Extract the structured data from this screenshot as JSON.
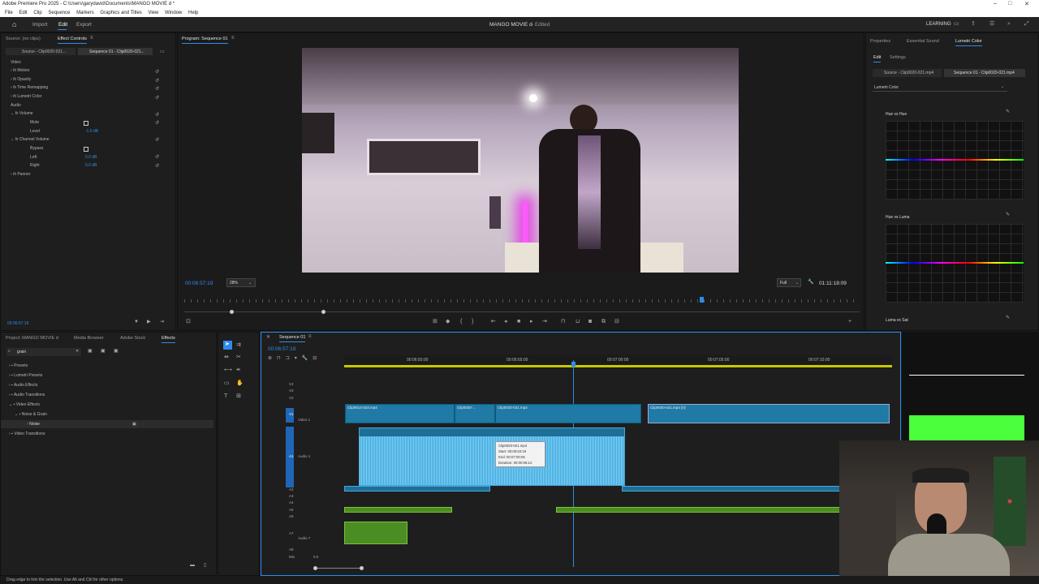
{
  "window": {
    "title": "Adobe Premiere Pro 2025 - C:\\Users\\garydavid\\Documents\\MANGO MOVIE d *"
  },
  "menu": [
    "File",
    "Edit",
    "Clip",
    "Sequence",
    "Markers",
    "Graphics and Titles",
    "View",
    "Window",
    "Help"
  ],
  "header": {
    "import": "Import",
    "edit": "Edit",
    "export": "Export",
    "doc_title": "MANGO MOVIE d",
    "doc_status": "- Edited",
    "learning": "LEARNING"
  },
  "effect_controls": {
    "tabs": [
      "Source: (no clips)",
      "Effect Controls"
    ],
    "source_tab": "Source - Clip0020-021...",
    "sequence_tab": "Sequence 01 - Clip0020-021...",
    "video_heading": "Video",
    "video_items": [
      "Motion",
      "Opacity",
      "Time Remapping",
      "Lumetri Color"
    ],
    "audio_heading": "Audio",
    "volume": "Volume",
    "mute": "Mute",
    "level": "Level",
    "level_value": "-1.6 dB",
    "channel_volume": "Channel Volume",
    "bypass": "Bypass",
    "left": "Left",
    "left_value": "0.0 dB",
    "right": "Right",
    "right_value": "0.0 dB",
    "panner": "Panner",
    "timecode": "00:06:57:19"
  },
  "program": {
    "tab": "Program: Sequence 01",
    "timecode": "00:06:57:19",
    "zoom": "28%",
    "quality": "Full",
    "duration": "01:11:18:09"
  },
  "lumetri": {
    "tabs": [
      "Properties",
      "Essential Sound",
      "Lumetri Color"
    ],
    "subtabs": [
      "Edit",
      "Settings"
    ],
    "source": "Source - Clip0020-021.mp4",
    "sequence": "Sequence 01 - Clip0020-021.mp4",
    "effect_select": "Lumetri Color",
    "curve1": "Hue vs Hue",
    "curve2": "Hue vs Luma",
    "curve3": "Luma vs Sat"
  },
  "project": {
    "tabs": [
      "Project: MANGO MOVIE d",
      "Media Browser",
      "Adobe Stock",
      "Effects"
    ],
    "search": "grain",
    "tree": [
      "Presets",
      "Lumetri Presets",
      "Audio Effects",
      "Audio Transitions",
      "Video Effects",
      "Noise & Grain",
      "Noise",
      "Video Transitions"
    ]
  },
  "timeline": {
    "tab": "Sequence 01",
    "timecode": "00:06:57:19",
    "ruler": [
      "00:06:50:00",
      "00:06:55:00",
      "00:07:00:00",
      "00:07:05:00",
      "00:07:10:00"
    ],
    "tracks_video": [
      "V4",
      "V3",
      "V2",
      "V1"
    ],
    "video1": "Video 1",
    "tracks_audio": [
      "A1",
      "A2",
      "A3",
      "A4",
      "A5",
      "A6",
      "A7",
      "A8"
    ],
    "audio1": "Audio 1",
    "audio7": "Audio 7",
    "mix": "Mix",
    "mix_value": "0.0",
    "clips": [
      "Clip0014-024.mp4",
      "Clip0020-...",
      "Clip0020-021.mp4",
      "Clip0020-021.mp4 [V]"
    ],
    "tooltip": {
      "name": "Clip0020-021.mp4",
      "start": "Start: 00:06:53:19",
      "end": "End: 00:07:00:06",
      "duration": "Duration: 00:00:06:12"
    }
  },
  "status": "Drag edge to trim the selection. Use Alt and Ctrl for other options."
}
